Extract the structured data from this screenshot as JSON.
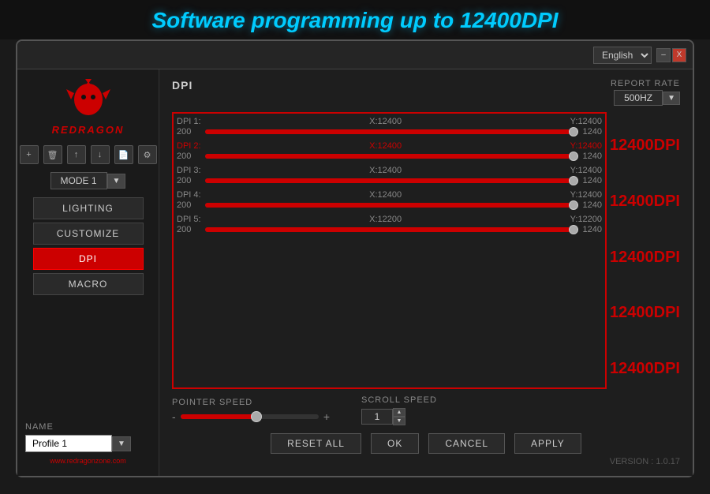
{
  "title": "Software programming up to 12400DPI",
  "header": {
    "language": "English",
    "minimize": "–",
    "close": "X"
  },
  "sidebar": {
    "brand": "REDRAGON",
    "mode": "MODE 1",
    "mode_arrow": "▼",
    "icons": [
      "+",
      "🗑",
      "☁",
      "☁",
      "📋",
      "⚙"
    ],
    "nav_items": [
      {
        "label": "LIGHTING",
        "active": false
      },
      {
        "label": "CUSTOMIZE",
        "active": false
      },
      {
        "label": "DPI",
        "active": true
      },
      {
        "label": "MACRO",
        "active": false
      }
    ],
    "name_label": "NAME",
    "profile_name": "Profile 1",
    "website": "www.redragonzone.com"
  },
  "main": {
    "dpi_title": "DPI",
    "report_rate_label": "REPORT RATE",
    "report_rate_value": "500HZ",
    "dpi_rows": [
      {
        "label": "DPI 1:",
        "active": false,
        "x": "X:12400",
        "y": "Y:12400",
        "value": 200,
        "percent": 100,
        "right_label": "12400DPI"
      },
      {
        "label": "DPI 2:",
        "active": true,
        "x": "X:12400",
        "y": "Y:12400",
        "value": 200,
        "percent": 100,
        "right_label": "12400DPI"
      },
      {
        "label": "DPI 3:",
        "active": false,
        "x": "X:12400",
        "y": "Y:12400",
        "value": 200,
        "percent": 100,
        "right_label": "12400DPI"
      },
      {
        "label": "DPI 4:",
        "active": false,
        "x": "X:12400",
        "y": "Y:12400",
        "value": 200,
        "percent": 100,
        "right_label": "12400DPI"
      },
      {
        "label": "DPI 5:",
        "active": false,
        "x": "X:12200",
        "y": "Y:12200",
        "value": 200,
        "percent": 100,
        "right_label": "12400DPI"
      }
    ],
    "pointer_speed_label": "POINTER SPEED",
    "pointer_minus": "-",
    "pointer_plus": "+",
    "scroll_speed_label": "SCROLL SPEED",
    "scroll_value": "1",
    "buttons": {
      "reset_all": "RESET ALL",
      "ok": "OK",
      "cancel": "CANCEL",
      "apply": "APPLY"
    },
    "version": "VERSION : 1.0.17"
  }
}
